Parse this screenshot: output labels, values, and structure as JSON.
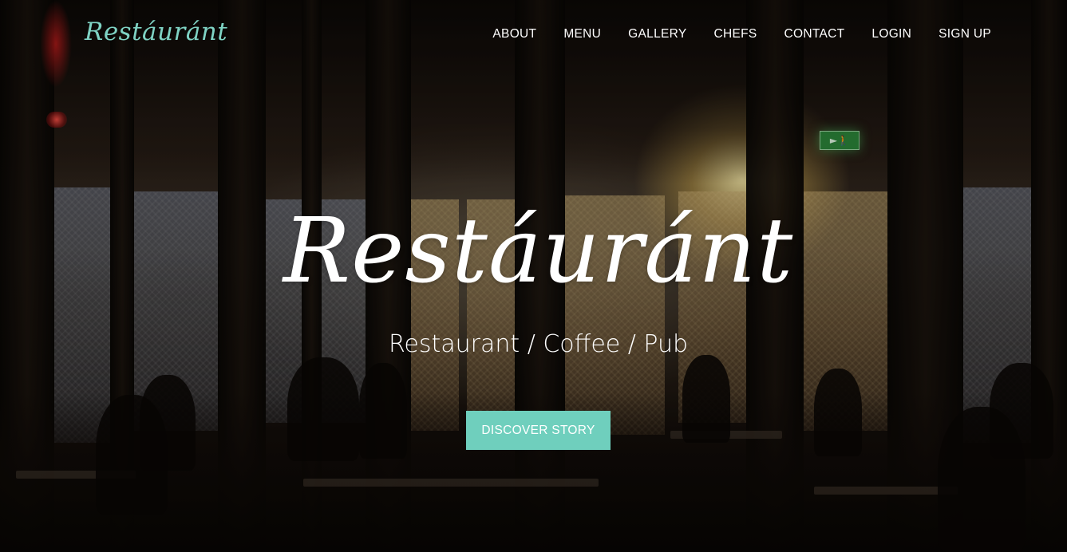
{
  "brand": {
    "logo_text": "Restáuránt",
    "accent_color": "#6fcfbd"
  },
  "nav": {
    "items": [
      {
        "label": "ABOUT"
      },
      {
        "label": "MENU"
      },
      {
        "label": "GALLERY"
      },
      {
        "label": "CHEFS"
      },
      {
        "label": "CONTACT"
      },
      {
        "label": "LOGIN"
      },
      {
        "label": "SIGN UP"
      }
    ]
  },
  "hero": {
    "title": "Restáuránt",
    "subtitle": "Restaurant / Coffee / Pub",
    "cta_label": "DISCOVER STORY"
  }
}
